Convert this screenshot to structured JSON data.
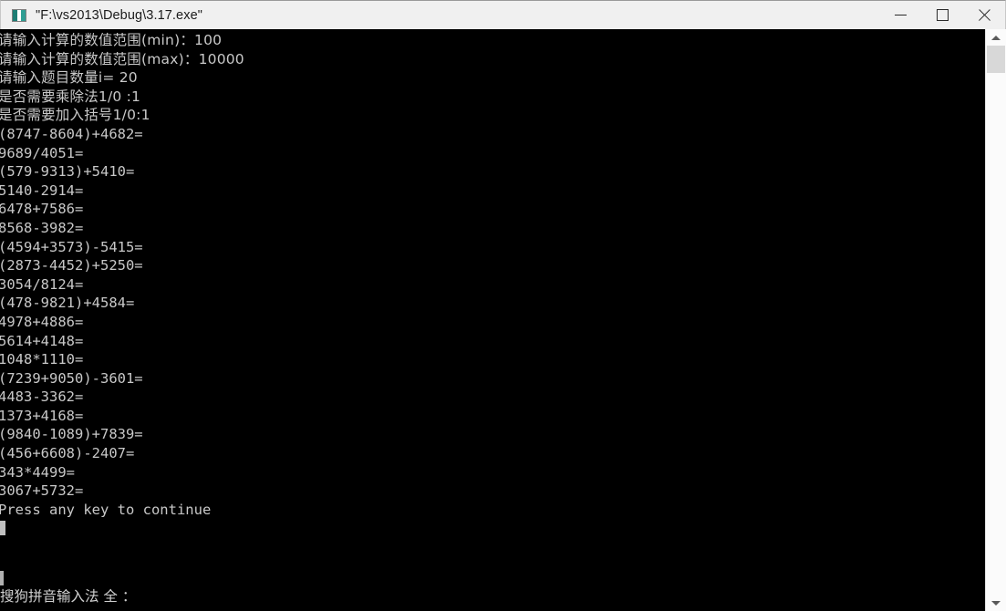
{
  "window": {
    "title": "\"F:\\vs2013\\Debug\\3.17.exe\"",
    "icon": "console-app-icon",
    "background_color": "#000000",
    "titlebar_color": "#f0f0f0",
    "text_color": "#c8c8c8"
  },
  "titlebar_buttons": {
    "minimize": "minimize-icon",
    "maximize": "maximize-icon",
    "close": "close-icon"
  },
  "console": {
    "prompts": [
      "请输入计算的数值范围(min)：100",
      "请输入计算的数值范围(max)：10000",
      "请输入题目数量i= 20",
      "是否需要乘除法1/0 :1",
      "是否需要加入括号1/0:1"
    ],
    "expressions": [
      "(8747-8604)+4682=",
      "9689/4051=",
      "(579-9313)+5410=",
      "5140-2914=",
      "6478+7586=",
      "8568-3982=",
      "(4594+3573)-5415=",
      "(2873-4452)+5250=",
      "3054/8124=",
      "(478-9821)+4584=",
      "4978+4886=",
      "5614+4148=",
      "1048*1110=",
      "(7239+9050)-3601=",
      "4483-3362=",
      "1373+4168=",
      "(9840-1089)+7839=",
      "(456+6608)-2407=",
      "343*4499=",
      "3067+5732="
    ],
    "footer": "Press any key to continue"
  },
  "ime": {
    "status": "搜狗拼音输入法 全 ："
  },
  "scrollbar": {
    "up_arrow": "scroll-up-icon",
    "down_arrow": "scroll-down-icon"
  }
}
